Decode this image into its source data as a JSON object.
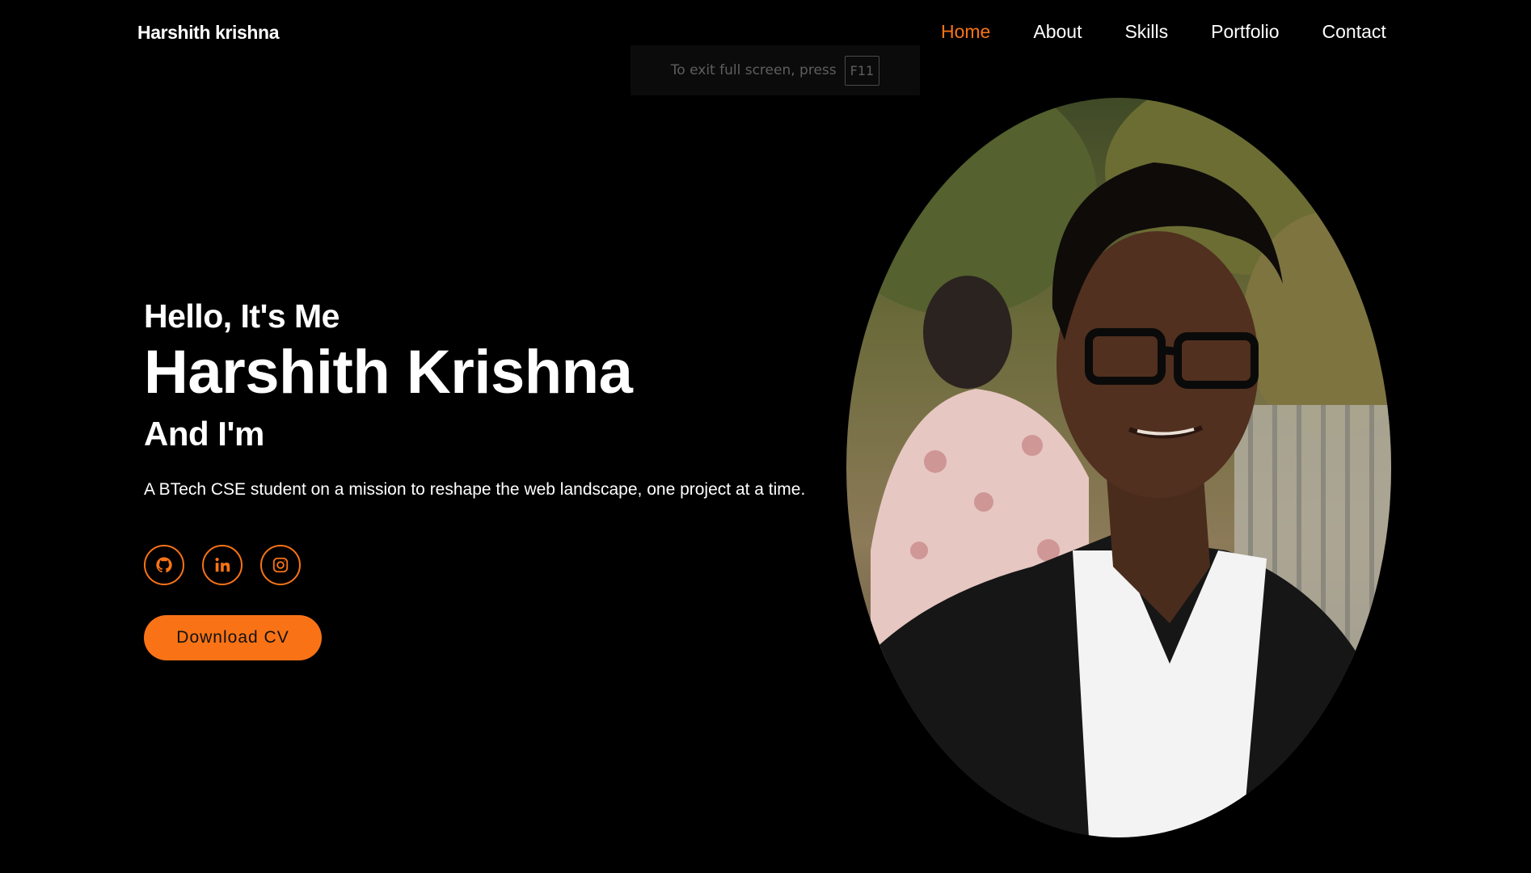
{
  "header": {
    "logo": "Harshith krishna",
    "nav": [
      {
        "label": "Home",
        "active": true
      },
      {
        "label": "About",
        "active": false
      },
      {
        "label": "Skills",
        "active": false
      },
      {
        "label": "Portfolio",
        "active": false
      },
      {
        "label": "Contact",
        "active": false
      }
    ]
  },
  "fullscreen_notice": {
    "text": "To exit full screen, press",
    "key": "F11"
  },
  "hero": {
    "greeting": "Hello, It's Me",
    "name": "Harshith Krishna",
    "subtitle": "And I'm",
    "description": "A BTech CSE student on a mission to reshape the web landscape, one project at a time.",
    "socials": [
      {
        "icon": "github-icon"
      },
      {
        "icon": "linkedin-icon"
      },
      {
        "icon": "instagram-icon"
      }
    ],
    "cv_button": "Download CV"
  },
  "colors": {
    "accent": "#f97316",
    "background": "#000000",
    "text": "#ffffff"
  }
}
